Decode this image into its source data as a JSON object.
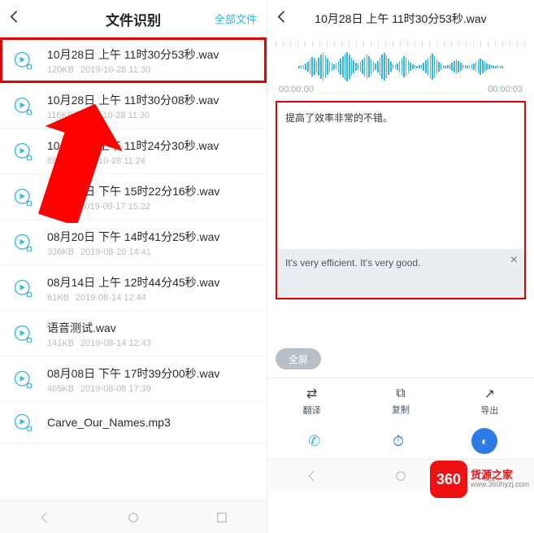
{
  "left": {
    "title": "文件识别",
    "action": "全部文件",
    "files": [
      {
        "name": "10月28日 上午 11时30分53秒.wav",
        "size": "120KB",
        "date": "2019-10-28 11:30",
        "hl": true
      },
      {
        "name": "10月28日 上午 11时30分08秒.wav",
        "size": "116KB",
        "date": "2019-10-28 11:30"
      },
      {
        "name": "10月28日 上午 11时24分30秒.wav",
        "size": "88KB",
        "date": "2019-10-28 11:24"
      },
      {
        "name": "09月17日 下午 15时22分16秒.wav",
        "size": "116KB",
        "date": "2019-09-17 15:22"
      },
      {
        "name": "08月20日 下午 14时41分25秒.wav",
        "size": "336KB",
        "date": "2019-08-20 14:41"
      },
      {
        "name": "08月14日 上午 12时44分45秒.wav",
        "size": "61KB",
        "date": "2019-08-14 12:44"
      },
      {
        "name": "语音测试.wav",
        "size": "141KB",
        "date": "2019-08-14 12:43"
      },
      {
        "name": "08月08日 下午 17时39分00秒.wav",
        "size": "465KB",
        "date": "2019-08-08 17:39"
      },
      {
        "name": "Carve_Our_Names.mp3",
        "size": "",
        "date": ""
      }
    ]
  },
  "right": {
    "title": "10月28日 上午 11时30分53秒.wav",
    "time_start": "00:00:00",
    "time_end": "00:00:03",
    "orig": "提高了效率非常的不错。",
    "trans": "It's very efficient. It's very good.",
    "full_btn": "全屏",
    "actions": {
      "translate": "翻译",
      "copy": "复制",
      "export": "导出"
    }
  },
  "logo": {
    "num": "360",
    "title": "货源之家",
    "url": "www.360hyzj.com"
  }
}
